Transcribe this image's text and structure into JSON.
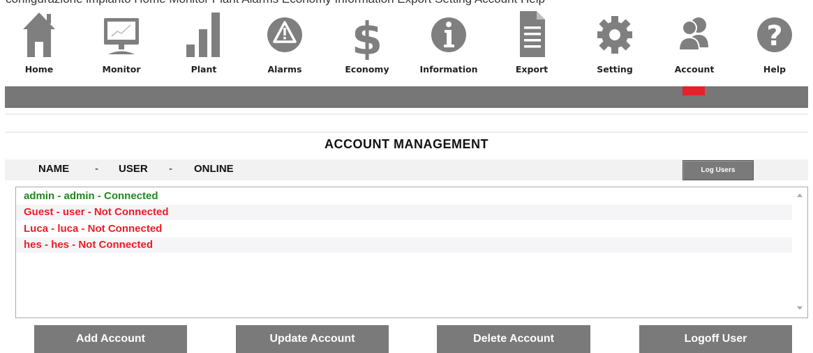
{
  "top_text": "configurazione impianto Home Monitor Plant Alarms Economy Information Export Setting Account Help",
  "nav": [
    {
      "label": "Home",
      "icon": "home-icon"
    },
    {
      "label": "Monitor",
      "icon": "monitor-icon"
    },
    {
      "label": "Plant",
      "icon": "bar-chart-icon"
    },
    {
      "label": "Alarms",
      "icon": "warning-icon"
    },
    {
      "label": "Economy",
      "icon": "dollar-icon"
    },
    {
      "label": "Information",
      "icon": "info-icon"
    },
    {
      "label": "Export",
      "icon": "document-icon"
    },
    {
      "label": "Setting",
      "icon": "gear-icon"
    },
    {
      "label": "Account",
      "icon": "users-icon"
    },
    {
      "label": "Help",
      "icon": "help-icon"
    }
  ],
  "page_title": "ACCOUNT MANAGEMENT",
  "columns": {
    "name": "NAME",
    "sep1": "-",
    "user": "USER",
    "sep2": "-",
    "online": "ONLINE"
  },
  "log_users_button": "Log Users",
  "accounts": [
    {
      "text": "admin - admin - Connected",
      "status": "connected"
    },
    {
      "text": "Guest - user - Not Connected",
      "status": "not-connected"
    },
    {
      "text": "Luca - luca - Not Connected",
      "status": "not-connected"
    },
    {
      "text": "hes - hes - Not Connected",
      "status": "not-connected"
    }
  ],
  "buttons": {
    "add": "Add Account",
    "update": "Update Account",
    "delete": "Delete Account",
    "logoff": "Logoff User"
  },
  "colors": {
    "connected": "#1e8a1e",
    "not_connected": "#ee1c24",
    "icon": "#7f7f7f",
    "band": "#777777",
    "active_indicator": "#e8202a"
  }
}
